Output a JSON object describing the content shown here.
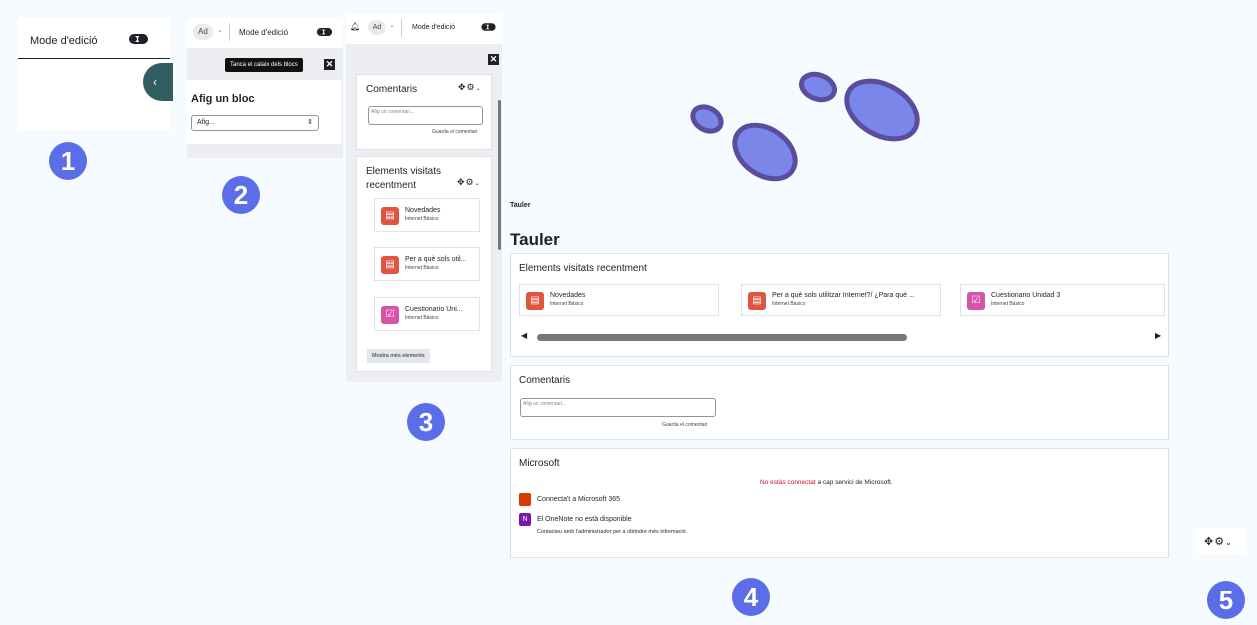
{
  "panel1": {
    "mode_label": "Mode d'edició"
  },
  "panel2": {
    "avatar": "Ad",
    "mode_label": "Mode d'edició",
    "tooltip": "Tanca el calaix dels blocs",
    "add_block_title": "Afig un bloc",
    "add_select": "Afig..."
  },
  "panel3": {
    "avatar": "Ad",
    "mode_label": "Mode d'edició",
    "comments_title": "Comentaris",
    "comment_placeholder": "Afig un comentari...",
    "save_comment": "Guarda el comentari",
    "recent_title_1": "Elements visitats",
    "recent_title_2": "recentment",
    "items": [
      {
        "title": "Novedades",
        "course": "Internet Básico",
        "color": "#e0553f"
      },
      {
        "title": "Per a què sols util...",
        "course": "Internet Básico",
        "color": "#e0553f"
      },
      {
        "title": "Cuestionario Uni...",
        "course": "Internet Básico",
        "color": "#d653a8"
      }
    ],
    "show_more": "Mostra més elements"
  },
  "panel4": {
    "breadcrumb": "Tauler",
    "page_title": "Tauler",
    "recent_title": "Elements visitats recentment",
    "items": [
      {
        "title": "Novedades",
        "course": "Internet Básico",
        "color": "#e0553f"
      },
      {
        "title": "Per a què sols utilitzar Internet?/ ¿Para qué ...",
        "course": "Internet Básico",
        "color": "#e0553f"
      },
      {
        "title": "Cuestionario Unidad 3",
        "course": "Internet Básico",
        "color": "#d653a8"
      }
    ],
    "comments_title": "Comentaris",
    "comment_placeholder": "Afig un comentari...",
    "save_comment": "Guarda el comentari",
    "ms_title": "Microsoft",
    "ms_not_connected": "No estàs connectat",
    "ms_not_connected_rest": "a cap servici de Microsoft.",
    "ms_connect": "Connecta't a Microsoft 365",
    "ms_onenote": "El OneNote no està disponible",
    "ms_contact": "Contacteu amb l'administrador per a obtindre més informació."
  },
  "badges": [
    "1",
    "2",
    "3",
    "4",
    "5"
  ],
  "colors": {
    "badge": "#5b6ee8",
    "footprint": "#7a86e8",
    "footprint_outline": "#5a4d9e",
    "drawer_tab": "#2f5d62",
    "alert_red": "#c8102e"
  }
}
